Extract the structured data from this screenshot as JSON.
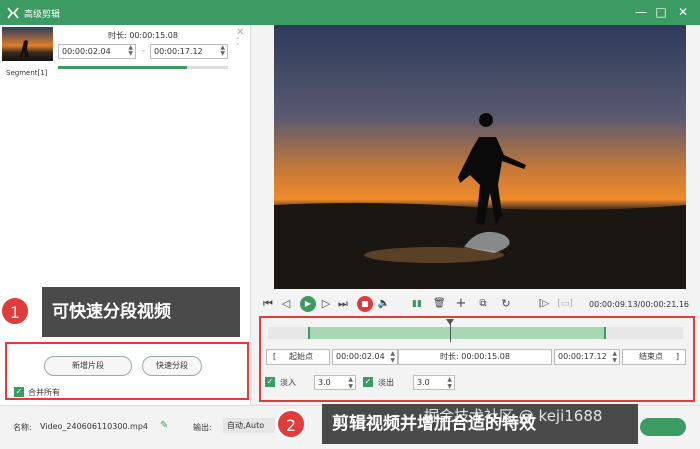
{
  "window": {
    "title": "高级剪辑",
    "icons": [
      "minimize-icon",
      "maximize-icon",
      "close-icon"
    ]
  },
  "segment_panel": {
    "duration_label": "时长:",
    "duration_value": "00:00:15.08",
    "start_time": "00:00:02.04",
    "end_time": "00:00:17.12",
    "separator": "-",
    "segment_label": "Segment[1]",
    "progress": 0.76
  },
  "callouts": {
    "one_num": "1",
    "one_text": "可快速分段视频",
    "two_num": "2",
    "two_text": "剪辑视频并增加合适的特效"
  },
  "segment_actions": {
    "new_segment": "新增片段",
    "quick_split": "快速分段",
    "merge_all": "合并所有"
  },
  "bottom": {
    "name_label": "名称:",
    "file_name": "Video_240606110300.mp4",
    "output_label": "输出:",
    "output_value": "自动,Auto"
  },
  "player": {
    "current_time": "00:00:09.13/00:00:21.16",
    "in_marker": "[",
    "out_marker": "]"
  },
  "trim": {
    "start_btn": "起始点",
    "start_time": "00:00:02.04",
    "duration_label": "时长:",
    "duration_value": "00:00:15.08",
    "end_time": "00:00:17.12",
    "end_btn": "结束点",
    "left_bracket": "[",
    "right_bracket": "]"
  },
  "fade": {
    "fade_in_label": "淡入",
    "fade_in_value": "3.0",
    "fade_out_label": "淡出",
    "fade_out_value": "3.0"
  },
  "watermark": "掘金技术社区 @ keji1688",
  "colors": {
    "accent": "#3c9b62",
    "alert": "#e23b3b"
  }
}
